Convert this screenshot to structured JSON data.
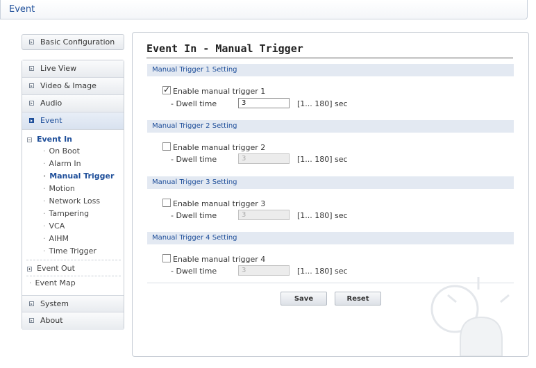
{
  "page_tab": "Event",
  "sidebar": {
    "basic_config": "Basic Configuration",
    "live_view": "Live View",
    "video_image": "Video & Image",
    "audio": "Audio",
    "event": "Event",
    "event_in": "Event In",
    "event_in_items": [
      "On Boot",
      "Alarm In",
      "Manual Trigger",
      "Motion",
      "Network Loss",
      "Tampering",
      "VCA",
      "AIHM",
      "Time Trigger"
    ],
    "event_out": "Event Out",
    "event_map": "Event Map",
    "system": "System",
    "about": "About"
  },
  "main": {
    "title": "Event In - Manual Trigger",
    "dwell_label": "- Dwell time",
    "range_label": "[1... 180] sec",
    "triggers": [
      {
        "heading": "Manual Trigger 1 Setting",
        "checkbox_label": "Enable manual trigger 1",
        "enabled": true,
        "dwell": "3"
      },
      {
        "heading": "Manual Trigger 2 Setting",
        "checkbox_label": "Enable manual trigger 2",
        "enabled": false,
        "dwell": "3"
      },
      {
        "heading": "Manual Trigger 3 Setting",
        "checkbox_label": "Enable manual trigger 3",
        "enabled": false,
        "dwell": "3"
      },
      {
        "heading": "Manual Trigger 4 Setting",
        "checkbox_label": "Enable manual trigger 4",
        "enabled": false,
        "dwell": "3"
      }
    ],
    "save_label": "Save",
    "reset_label": "Reset"
  },
  "colors": {
    "accent": "#1f4f9a",
    "section_bg": "#e3e9f2",
    "border": "#c6ccd4"
  }
}
